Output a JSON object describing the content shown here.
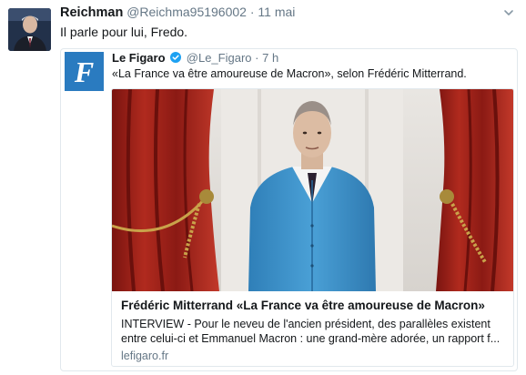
{
  "tweet": {
    "author_name": "Reichman",
    "author_handle": "@Reichma95196002",
    "separator": "·",
    "time": "11 mai",
    "text": "Il parle pour lui, Fredo."
  },
  "quoted": {
    "author_name": "Le Figaro",
    "author_handle": "@Le_Figaro",
    "separator": "·",
    "time": "7 h",
    "text": "«La France va être amoureuse de Macron», selon Frédéric Mitterrand.",
    "avatar_letter": "F",
    "card": {
      "title": "Frédéric Mitterrand  «La France va être amoureuse de Macron»",
      "description_line1": "INTERVIEW - Pour le neveu de l'ancien président, des parallèles existent",
      "description_line2": "entre celui-ci et Emmanuel Macron : une grand-mère adorée, un rapport f...",
      "domain": "lefigaro.fr"
    }
  },
  "colors": {
    "text": "#14171a",
    "secondary": "#657786",
    "border": "#e1e8ed",
    "figaro_blue": "#2a7bc0",
    "verified": "#1da1f2"
  },
  "icons": {
    "chevron": "chevron-down-icon",
    "verified": "verified-badge-icon"
  }
}
